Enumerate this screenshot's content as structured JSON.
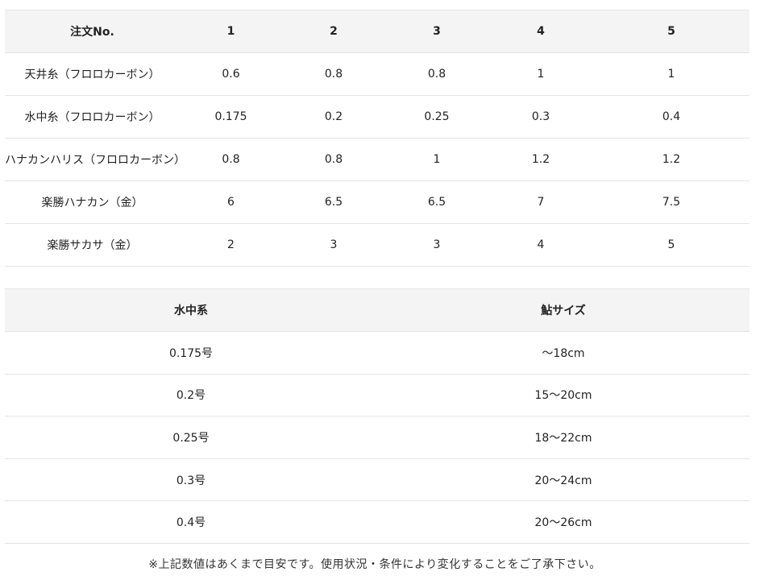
{
  "spec_table": {
    "header": [
      "注文No.",
      "1",
      "2",
      "3",
      "4",
      "5"
    ],
    "rows": [
      {
        "label": "天井糸（フロロカーボン）",
        "values": [
          "0.6",
          "0.8",
          "0.8",
          "1",
          "1"
        ]
      },
      {
        "label": "水中糸（フロロカーボン）",
        "values": [
          "0.175",
          "0.2",
          "0.25",
          "0.3",
          "0.4"
        ]
      },
      {
        "label": "ハナカンハリス（フロロカーボン）",
        "values": [
          "0.8",
          "0.8",
          "1",
          "1.2",
          "1.2"
        ]
      },
      {
        "label": "楽勝ハナカン（金）",
        "values": [
          "6",
          "6.5",
          "6.5",
          "7",
          "7.5"
        ]
      },
      {
        "label": "楽勝サカサ（金）",
        "values": [
          "2",
          "3",
          "3",
          "4",
          "5"
        ]
      }
    ]
  },
  "size_table": {
    "header": [
      "水中系",
      "鮎サイズ"
    ],
    "rows": [
      [
        "0.175号",
        "～18cm"
      ],
      [
        "0.2号",
        "15～20cm"
      ],
      [
        "0.25号",
        "18～22cm"
      ],
      [
        "0.3号",
        "20～24cm"
      ],
      [
        "0.4号",
        "20～26cm"
      ]
    ]
  },
  "note": "※上記数値はあくまで目安です。使用状況・条件により変化することをご了承下さい。"
}
